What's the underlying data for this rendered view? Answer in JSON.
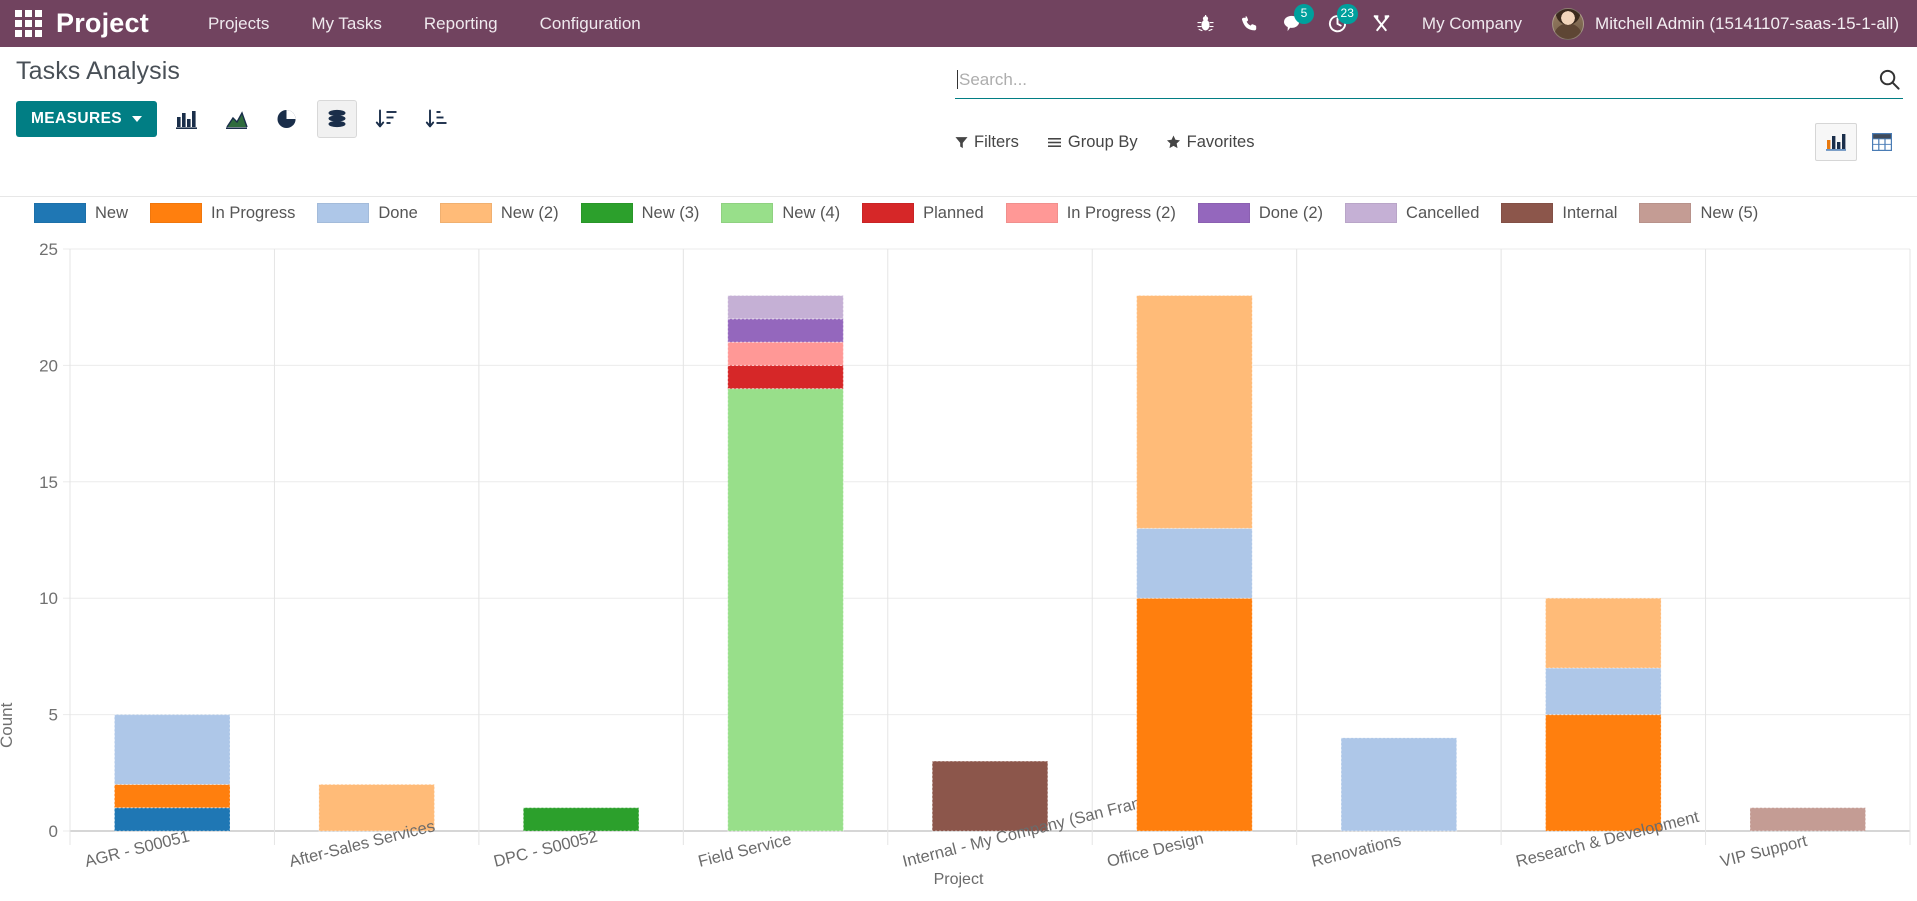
{
  "navbar": {
    "apps_icon": "grid-apps-icon",
    "brand": "Project",
    "menu": [
      {
        "label": "Projects"
      },
      {
        "label": "My Tasks"
      },
      {
        "label": "Reporting"
      },
      {
        "label": "Configuration"
      }
    ],
    "sys_icons": [
      {
        "name": "bug-icon",
        "badge": null
      },
      {
        "name": "phone-icon",
        "badge": null
      },
      {
        "name": "messages-icon",
        "badge": "5"
      },
      {
        "name": "activities-icon",
        "badge": "23"
      },
      {
        "name": "tools-icon",
        "badge": null
      }
    ],
    "company": "My Company",
    "user": "Mitchell Admin (15141107-saas-15-1-all)",
    "accent_bg": "#71435f",
    "badge_color": "#00a09d"
  },
  "control_panel": {
    "title": "Tasks Analysis",
    "measures_label": "MEASURES",
    "measures_color": "#017e84",
    "chart_type_buttons": [
      {
        "name": "bar-chart-icon",
        "active": false
      },
      {
        "name": "line-chart-icon",
        "active": false
      },
      {
        "name": "pie-chart-icon",
        "active": false
      },
      {
        "name": "stacked-icon",
        "active": true
      },
      {
        "name": "sort-desc-icon",
        "active": false
      },
      {
        "name": "sort-asc-icon",
        "active": false
      }
    ],
    "view_buttons": [
      {
        "name": "graph-view-icon",
        "active": true
      },
      {
        "name": "pivot-view-icon",
        "active": false
      }
    ]
  },
  "search": {
    "placeholder": "Search...",
    "value": "",
    "icon": "magnifier-icon"
  },
  "facets": [
    {
      "label": "Filters",
      "icon": "funnel-icon"
    },
    {
      "label": "Group By",
      "icon": "hamburger-icon"
    },
    {
      "label": "Favorites",
      "icon": "star-icon"
    }
  ],
  "chart_data": {
    "type": "bar",
    "stacked": true,
    "title": "Tasks Analysis",
    "xlabel": "Project",
    "ylabel": "Count",
    "ylim": [
      0,
      25
    ],
    "yticks": [
      0,
      5,
      10,
      15,
      20,
      25
    ],
    "grid": true,
    "legend_position": "top",
    "categories": [
      "AGR - S00051",
      "After-Sales Services",
      "DPC - S00052",
      "Field Service",
      "Internal - My Company (San Francisco)",
      "Office Design",
      "Renovations",
      "Research & Development",
      "VIP Support"
    ],
    "series": [
      {
        "name": "New",
        "color": "#1f77b4",
        "values": [
          1,
          0,
          0,
          0,
          0,
          0,
          0,
          0,
          0
        ]
      },
      {
        "name": "In Progress",
        "color": "#ff7f0e",
        "values": [
          1,
          0,
          0,
          0,
          0,
          10,
          0,
          5,
          0
        ]
      },
      {
        "name": "Done",
        "color": "#aec7e8",
        "values": [
          3,
          0,
          0,
          0,
          0,
          3,
          4,
          2,
          0
        ]
      },
      {
        "name": "New (2)",
        "color": "#ffbb78",
        "values": [
          0,
          2,
          0,
          0,
          0,
          10,
          0,
          3,
          0
        ]
      },
      {
        "name": "New (3)",
        "color": "#2ca02c",
        "values": [
          0,
          0,
          1,
          0,
          0,
          0,
          0,
          0,
          0
        ]
      },
      {
        "name": "New (4)",
        "color": "#98df8a",
        "values": [
          0,
          0,
          0,
          19,
          0,
          0,
          0,
          0,
          0
        ]
      },
      {
        "name": "Planned",
        "color": "#d62728",
        "values": [
          0,
          0,
          0,
          1,
          0,
          0,
          0,
          0,
          0
        ]
      },
      {
        "name": "In Progress (2)",
        "color": "#ff9896",
        "values": [
          0,
          0,
          0,
          1,
          0,
          0,
          0,
          0,
          0
        ]
      },
      {
        "name": "Done (2)",
        "color": "#9467bd",
        "values": [
          0,
          0,
          0,
          1,
          0,
          0,
          0,
          0,
          0
        ]
      },
      {
        "name": "Cancelled",
        "color": "#c5b0d5",
        "values": [
          0,
          0,
          0,
          1,
          0,
          0,
          0,
          0,
          0
        ]
      },
      {
        "name": "Internal",
        "color": "#8c564b",
        "values": [
          0,
          0,
          0,
          0,
          3,
          0,
          0,
          0,
          0
        ]
      },
      {
        "name": "New (5)",
        "color": "#c49c94",
        "values": [
          0,
          0,
          0,
          0,
          0,
          0,
          0,
          0,
          1
        ]
      }
    ],
    "totals": [
      5,
      2,
      1,
      23,
      3,
      23,
      4,
      10,
      1
    ]
  }
}
